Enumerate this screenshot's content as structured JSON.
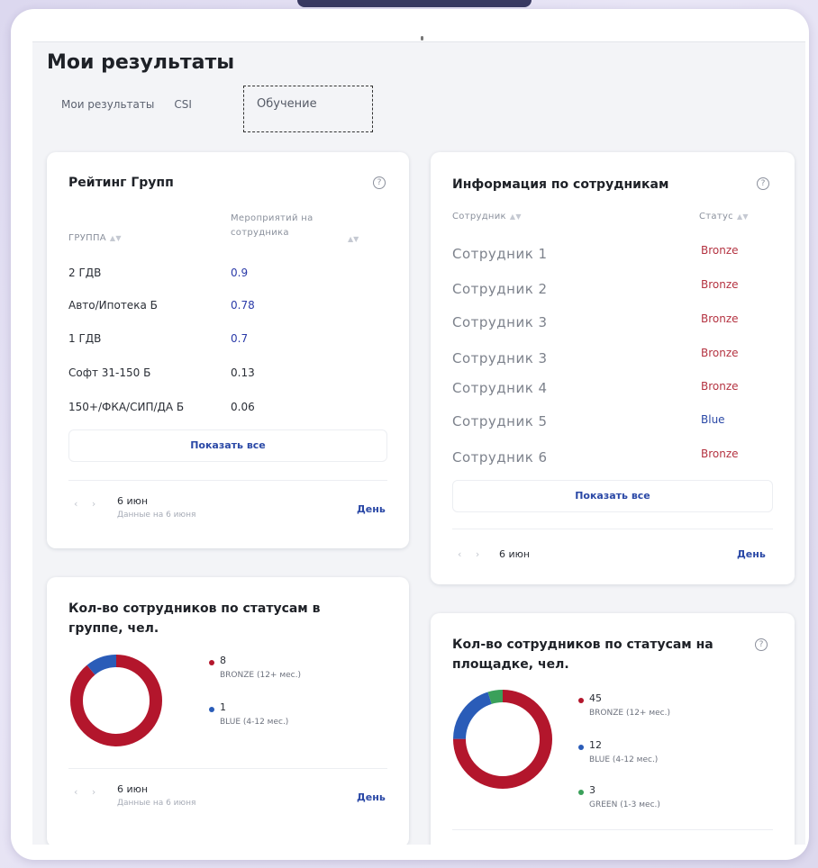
{
  "page": {
    "title": "Мои результаты"
  },
  "tabs": [
    {
      "label": "Мои результаты"
    },
    {
      "label": "CSI"
    },
    {
      "label": "Обучение"
    }
  ],
  "group_rating": {
    "title": "Рейтинг Групп",
    "col_group": "ГРУППА",
    "col_events_line1": "Мероприятий на",
    "col_events_line2": "сотрудника",
    "rows": [
      {
        "group": "2 ГДВ",
        "value": "0.9"
      },
      {
        "group": "Авто/Ипотека Б",
        "value": "0.78"
      },
      {
        "group": "1 ГДВ",
        "value": "0.7"
      },
      {
        "group": "Софт 31-150 Б",
        "value": "0.13"
      },
      {
        "group": "150+/ФКА/СИП/ДА Б",
        "value": "0.06"
      }
    ],
    "show_all": "Показать все",
    "date": "6 июн",
    "date_note": "Данные на 6 июня",
    "period": "День"
  },
  "employees": {
    "title": "Информация по сотрудникам",
    "col_employee": "Сотрудник",
    "col_status": "Статус",
    "rows": [
      {
        "name": "Сотрудник 1",
        "status": "Bronze"
      },
      {
        "name": "Сотрудник 2",
        "status": "Bronze"
      },
      {
        "name": "Сотрудник 3",
        "status": "Bronze"
      },
      {
        "name": "Сотрудник 3",
        "status": "Bronze"
      },
      {
        "name": "Сотрудник 4",
        "status": "Bronze"
      },
      {
        "name": "Сотрудник 5",
        "status": "Blue"
      },
      {
        "name": "Сотрудник 6",
        "status": "Bronze"
      }
    ],
    "show_all": "Показать все",
    "date": "6 июн",
    "period": "День"
  },
  "group_status": {
    "title_line1": "Кол-во сотрудников по статусам в",
    "title_line2": "группе, чел.",
    "legend": [
      {
        "value": "8",
        "label": "BRONZE (12+ мес.)",
        "color": "#b3162c"
      },
      {
        "value": "1",
        "label": "BLUE (4-12 мес.)",
        "color": "#2a5cb8"
      }
    ],
    "date": "6 июн",
    "date_note": "Данные на 6 июня",
    "period": "День"
  },
  "site_status": {
    "title_line1": "Кол-во сотрудников по статусам на",
    "title_line2": "площадке, чел.",
    "legend": [
      {
        "value": "45",
        "label": "BRONZE (12+ мес.)",
        "color": "#b3162c"
      },
      {
        "value": "12",
        "label": "BLUE (4-12 мес.)",
        "color": "#2a5cb8"
      },
      {
        "value": "3",
        "label": "GREEN (1-3 мес.)",
        "color": "#3aa05a"
      }
    ]
  },
  "colors": {
    "accent_blue": "#2a48a6",
    "bronze_text": "#b43341",
    "donut_red": "#b3162c",
    "donut_blue": "#2a5cb8",
    "donut_green": "#3aa05a"
  }
}
